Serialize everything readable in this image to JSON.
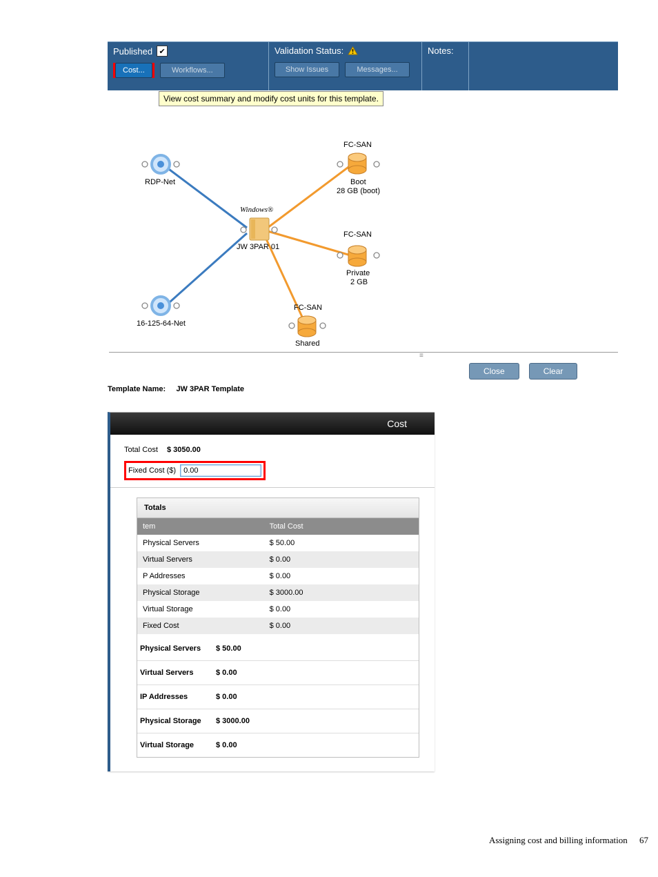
{
  "toolbar": {
    "published_label": "Published",
    "validation_label": "Validation Status:",
    "notes_label": "Notes:",
    "cost_btn": "Cost...",
    "workflows_btn": "Workflows...",
    "show_issues_btn": "Show Issues",
    "messages_btn": "Messages..."
  },
  "tooltip": "View cost summary and modify cost units for this template.",
  "diagram": {
    "rdp_net": "RDP-Net",
    "net_16": "16-125-64-Net",
    "windows": "Windows®",
    "jw3par": "JW 3PAR 01",
    "fcsan1": "FC-SAN",
    "fcsan2": "FC-SAN",
    "fcsan3": "FC-SAN",
    "boot_l1": "Boot",
    "boot_l2": "28 GB (boot)",
    "private_l1": "Private",
    "private_l2": "2 GB",
    "shared": "Shared"
  },
  "buttons": {
    "close": "Close",
    "clear": "Clear"
  },
  "template_name_label": "Template Name:",
  "template_name_value": "JW 3PAR Template",
  "cost": {
    "header": "Cost",
    "total_label": "Total Cost",
    "total_value": "$ 3050.00",
    "fixed_label": "Fixed Cost ($)",
    "fixed_value": "0.00",
    "totals_section": "Totals",
    "col_item": "tem",
    "col_total": "Total Cost",
    "rows": [
      {
        "item": "Physical Servers",
        "cost": "$ 50.00"
      },
      {
        "item": "Virtual Servers",
        "cost": "$ 0.00"
      },
      {
        "item": "P Addresses",
        "cost": "$ 0.00"
      },
      {
        "item": "Physical Storage",
        "cost": "$ 3000.00"
      },
      {
        "item": "Virtual Storage",
        "cost": "$ 0.00"
      },
      {
        "item": "Fixed Cost",
        "cost": "$ 0.00"
      }
    ],
    "summary": [
      {
        "label": "Physical Servers",
        "value": "$ 50.00"
      },
      {
        "label": "Virtual Servers",
        "value": "$ 0.00"
      },
      {
        "label": "IP Addresses",
        "value": "$ 0.00"
      },
      {
        "label": "Physical Storage",
        "value": "$ 3000.00"
      },
      {
        "label": "Virtual Storage",
        "value": "$ 0.00"
      }
    ]
  },
  "footer": {
    "text": "Assigning cost and billing information",
    "page": "67"
  }
}
